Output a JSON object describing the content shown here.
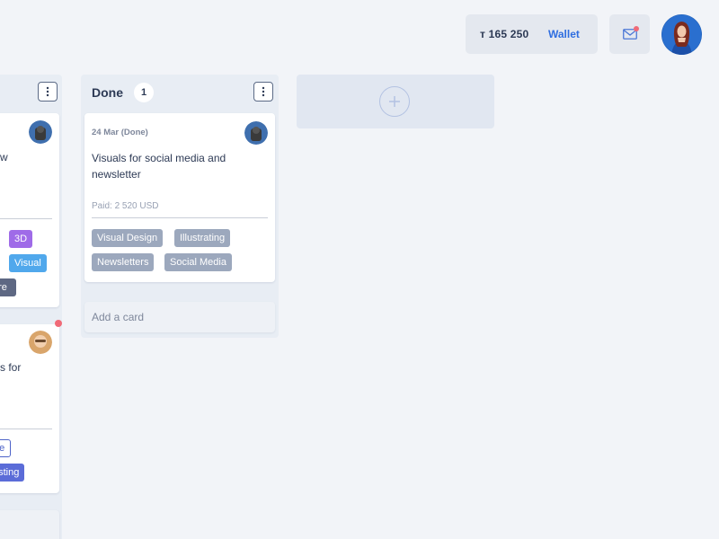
{
  "header": {
    "balance": "т 165 250",
    "wallet_label": "Wallet",
    "mail_icon": "mail-icon",
    "avatar_icon": "user-avatar"
  },
  "columns": [
    {
      "id": "left-partial",
      "cards": [
        {
          "text_lines": [
            "w"
          ],
          "tags": [
            "3D",
            "Visual",
            "ore"
          ]
        },
        {
          "text_lines": [
            "s for"
          ],
          "tags": [
            "ue",
            "esting"
          ]
        }
      ]
    },
    {
      "id": "done",
      "title": "Done",
      "count": "1",
      "cards": [
        {
          "date": "24 Mar (Done)",
          "title": "Visuals for social media and newsletter",
          "paid": "Paid: 2 520 USD",
          "tags": [
            "Visual Design",
            "Illustrating",
            "Newsletters",
            "Social Media"
          ]
        }
      ],
      "add_card_label": "Add a card"
    }
  ],
  "colors": {
    "accent": "#2f6ee0",
    "notification": "#f06a77",
    "tag_gray": "#9ca8bd",
    "tag_purple": "#9f6be8",
    "tag_blue": "#50a8ec"
  }
}
